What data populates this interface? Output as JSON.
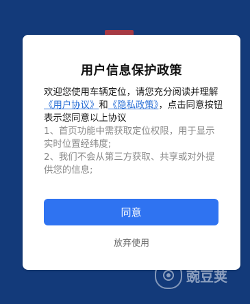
{
  "dialog": {
    "title": "用户信息保护政策",
    "intro": "欢迎您使用车辆定位，请您充分阅读并理解",
    "link_user_agreement": "《用户协议》",
    "conjunction": "和",
    "link_privacy_policy": "《隐私政策》",
    "after_links": "，点击同意按钮表示您同意以上协议",
    "item1": "1、首页功能中需获取定位权限，用于显示实时位置经纬度;",
    "item2": "2、我们不会从第三方获取、共享或对外提供您的信息;",
    "agree_button": "同意",
    "decline_button": "放弃使用"
  },
  "watermark": {
    "text": "豌豆荚",
    "icon": "pea-logo-icon"
  }
}
